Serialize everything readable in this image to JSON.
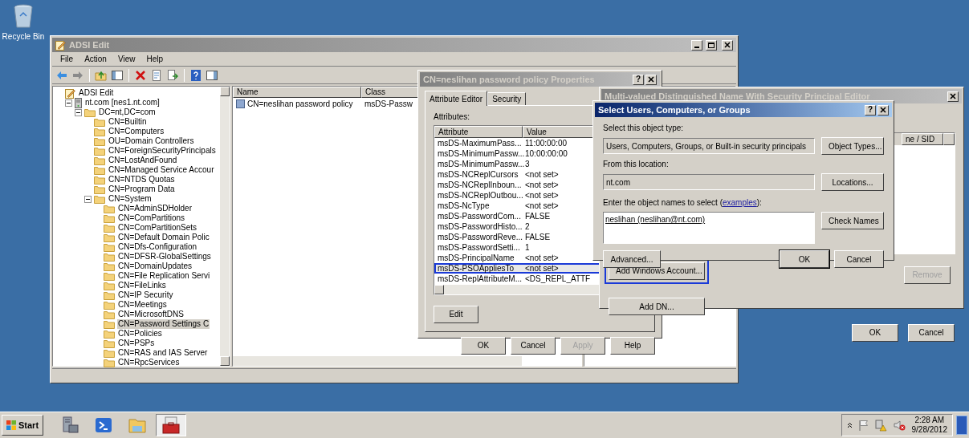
{
  "desktop": {
    "icons": [
      {
        "label": "Recycle Bin"
      }
    ]
  },
  "adsi_window": {
    "title": "ADSI Edit",
    "active": false,
    "menu": [
      "File",
      "Action",
      "View",
      "Help"
    ],
    "tree": [
      {
        "label": "ADSI Edit",
        "kind": "root",
        "selected": false,
        "children": [
          {
            "label": "nt.com [nes1.nt.com]",
            "kind": "server",
            "expanded": true,
            "selected": false,
            "children": [
              {
                "label": "DC=nt,DC=com",
                "kind": "folder",
                "expanded": true,
                "selected": false,
                "children": [
                  {
                    "label": "CN=Builtin",
                    "kind": "folder",
                    "selected": false
                  },
                  {
                    "label": "CN=Computers",
                    "kind": "folder",
                    "selected": false
                  },
                  {
                    "label": "OU=Domain Controllers",
                    "kind": "folder",
                    "selected": false
                  },
                  {
                    "label": "CN=ForeignSecurityPrincipals",
                    "kind": "folder",
                    "selected": false
                  },
                  {
                    "label": "CN=LostAndFound",
                    "kind": "folder",
                    "selected": false
                  },
                  {
                    "label": "CN=Managed Service Accour",
                    "kind": "folder",
                    "selected": false
                  },
                  {
                    "label": "CN=NTDS Quotas",
                    "kind": "folder",
                    "selected": false
                  },
                  {
                    "label": "CN=Program Data",
                    "kind": "folder",
                    "selected": false
                  },
                  {
                    "label": "CN=System",
                    "kind": "folder",
                    "expanded": true,
                    "selected": false,
                    "children": [
                      {
                        "label": "CN=AdminSDHolder",
                        "kind": "folder",
                        "selected": false
                      },
                      {
                        "label": "CN=ComPartitions",
                        "kind": "folder",
                        "selected": false
                      },
                      {
                        "label": "CN=ComPartitionSets",
                        "kind": "folder",
                        "selected": false
                      },
                      {
                        "label": "CN=Default Domain Polic",
                        "kind": "folder",
                        "selected": false
                      },
                      {
                        "label": "CN=Dfs-Configuration",
                        "kind": "folder",
                        "selected": false
                      },
                      {
                        "label": "CN=DFSR-GlobalSettings",
                        "kind": "folder",
                        "selected": false
                      },
                      {
                        "label": "CN=DomainUpdates",
                        "kind": "folder",
                        "selected": false
                      },
                      {
                        "label": "CN=File Replication Servi",
                        "kind": "folder",
                        "selected": false
                      },
                      {
                        "label": "CN=FileLinks",
                        "kind": "folder",
                        "selected": false
                      },
                      {
                        "label": "CN=IP Security",
                        "kind": "folder",
                        "selected": false
                      },
                      {
                        "label": "CN=Meetings",
                        "kind": "folder",
                        "selected": false
                      },
                      {
                        "label": "CN=MicrosoftDNS",
                        "kind": "folder",
                        "selected": false
                      },
                      {
                        "label": "CN=Password Settings C",
                        "kind": "folder",
                        "selected": true
                      },
                      {
                        "label": "CN=Policies",
                        "kind": "folder",
                        "selected": false
                      },
                      {
                        "label": "CN=PSPs",
                        "kind": "folder",
                        "selected": false
                      },
                      {
                        "label": "CN=RAS and IAS Server",
                        "kind": "folder",
                        "selected": false
                      },
                      {
                        "label": "CN=RpcServices",
                        "kind": "folder",
                        "selected": false
                      }
                    ]
                  }
                ]
              }
            ]
          }
        ]
      }
    ],
    "list": {
      "columns": [
        "Name",
        "Class"
      ],
      "rows": [
        {
          "name": "CN=neslihan password policy",
          "class": "msDS-Passw"
        }
      ]
    }
  },
  "properties_dialog": {
    "title": "CN=neslihan password policy Properties",
    "active": false,
    "help_button": "?",
    "tabs": [
      {
        "label": "Attribute Editor",
        "selected": true
      },
      {
        "label": "Security",
        "selected": false
      }
    ],
    "attributes_label": "Attributes:",
    "columns": [
      "Attribute",
      "Value"
    ],
    "rows": [
      {
        "attribute": "msDS-MaximumPass...",
        "value": "11:00:00:00",
        "highlighted": false
      },
      {
        "attribute": "msDS-MinimumPassw...",
        "value": "10:00:00:00",
        "highlighted": false
      },
      {
        "attribute": "msDS-MinimumPassw...",
        "value": "3",
        "highlighted": false
      },
      {
        "attribute": "msDS-NCReplCursors",
        "value": "<not set>",
        "highlighted": false
      },
      {
        "attribute": "msDS-NCReplInboun...",
        "value": "<not set>",
        "highlighted": false
      },
      {
        "attribute": "msDS-NCReplOutbou...",
        "value": "<not set>",
        "highlighted": false
      },
      {
        "attribute": "msDS-NcType",
        "value": "<not set>",
        "highlighted": false
      },
      {
        "attribute": "msDS-PasswordCom...",
        "value": "FALSE",
        "highlighted": false
      },
      {
        "attribute": "msDS-PasswordHisto...",
        "value": "2",
        "highlighted": false
      },
      {
        "attribute": "msDS-PasswordReve...",
        "value": "FALSE",
        "highlighted": false
      },
      {
        "attribute": "msDS-PasswordSetti...",
        "value": "1",
        "highlighted": false
      },
      {
        "attribute": "msDS-PrincipalName",
        "value": "<not set>",
        "highlighted": false
      },
      {
        "attribute": "msDS-PSOAppliesTo",
        "value": "<not set>",
        "highlighted": true
      },
      {
        "attribute": "msDS-ReplAttributeM...",
        "value": "<DS_REPL_ATTF",
        "highlighted": false
      }
    ],
    "edit_button": {
      "label": "Edit",
      "disabled": false
    },
    "buttons": [
      {
        "label": "OK",
        "disabled": false
      },
      {
        "label": "Cancel",
        "disabled": false
      },
      {
        "label": "Apply",
        "disabled": true
      },
      {
        "label": "Help",
        "disabled": false
      }
    ]
  },
  "multi_valued_dialog": {
    "title": "Multi-valued Distinguished Name With Security Principal Editor",
    "active": false,
    "visible_columns": [
      "ne / SID"
    ],
    "buttons": [
      {
        "label": "Add Windows Account...",
        "disabled": false,
        "highlighted": true
      },
      {
        "label": "Add DN...",
        "disabled": false,
        "highlighted": false
      },
      {
        "label": "Remove",
        "disabled": true,
        "highlighted": false
      },
      {
        "label": "OK",
        "disabled": false,
        "highlighted": false
      },
      {
        "label": "Cancel",
        "disabled": false,
        "highlighted": false
      }
    ]
  },
  "select_dialog": {
    "title": "Select Users, Computers, or Groups",
    "active": true,
    "help_button": "?",
    "object_type": {
      "label": "Select this object type:",
      "value": "Users, Computers, Groups, or Built-in security principals",
      "button": "Object Types..."
    },
    "location": {
      "label": "From this location:",
      "value": "nt.com",
      "button": "Locations..."
    },
    "names": {
      "label_before": "Enter the object names to select (",
      "link": "examples",
      "label_after": "):",
      "value": "neslihan (neslihan@nt.com)",
      "button": "Check Names"
    },
    "buttons": [
      {
        "label": "Advanced...",
        "default": false
      },
      {
        "label": "OK",
        "default": true
      },
      {
        "label": "Cancel",
        "default": false
      }
    ]
  },
  "taskbar": {
    "start": "Start",
    "items": [
      {
        "selected": false
      },
      {
        "selected": false
      },
      {
        "selected": false
      },
      {
        "selected": true
      }
    ],
    "time": "2:28 AM",
    "date": "9/28/2012"
  }
}
